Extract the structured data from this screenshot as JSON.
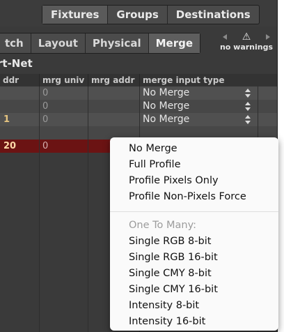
{
  "top_tabs": [
    "Fixtures",
    "Groups",
    "Destinations"
  ],
  "sub_tabs": [
    "tch",
    "Layout",
    "Physical",
    "Merge"
  ],
  "warnings": {
    "icon": "warning-icon",
    "text": "no warnings"
  },
  "section_title": "rt-Net",
  "columns": [
    "ddr",
    "mrg univ",
    "mrg addr",
    "merge input type"
  ],
  "rows": [
    {
      "addr": "",
      "mrg_univ": "0",
      "mrg_addr": "",
      "type": "No Merge"
    },
    {
      "addr": "",
      "mrg_univ": "0",
      "mrg_addr": "",
      "type": "No Merge"
    },
    {
      "addr": "1",
      "mrg_univ": "0",
      "mrg_addr": "",
      "type": "No Merge"
    },
    {
      "addr": "20",
      "mrg_univ": "0",
      "mrg_addr": "",
      "type": ""
    }
  ],
  "menu": {
    "items_top": [
      "No Merge",
      "Full Profile",
      "Profile Pixels Only",
      "Profile Non-Pixels Force"
    ],
    "group_header": "One To Many:",
    "items_group": [
      "Single RGB 8-bit",
      "Single RGB 16-bit",
      "Single CMY 8-bit",
      "Single CMY 16-bit",
      "Intensity 8-bit",
      "Intensity 16-bit"
    ]
  },
  "colors": {
    "background": "#3a3a3a",
    "selected_row": "#6b1313",
    "address_text": "#e6c480"
  }
}
